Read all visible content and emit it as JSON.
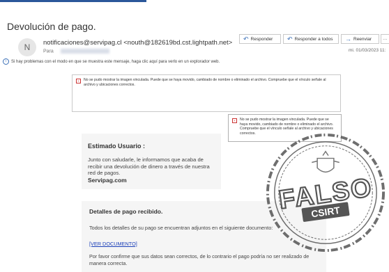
{
  "email": {
    "subject": "Devolución de pago.",
    "avatar_initial": "N",
    "sender": "notificaciones@servipag.cl <nouth@182619bd.cst.lightpath.net>",
    "to_label": "Para",
    "date": "mi. 01/03/2023 11:",
    "actions": {
      "reply": "Responder",
      "reply_all": "Responder a todos",
      "forward": "Reenviar",
      "more": "···"
    },
    "info_bar": "Si hay problemas con el modo en que se muestra este mensaje, haga clic aquí para verlo en un explorador web."
  },
  "broken_images": {
    "wide_text": "No se pudo mostrar la imagen vinculada. Puede que se haya movido, cambiado de nombre o eliminado el archivo. Compruebe que el vínculo señale al archivo y ubicaciones correctos.",
    "side_text": "No se pudo mostrar la imagen vinculada. Puede que se haya movido, cambiado de nombre o eliminado el archivo. Compruebe que el vínculo señale al archivo y ubicaciones correctos."
  },
  "message": {
    "greeting": "Estimado Usuario :",
    "body": "Junto con saludarle, le informamos que acaba de recibir una devolución de dinero a través de nuestra red de pagos.",
    "brand": "Servipag.com",
    "details_title": "Detalles de pago recibido.",
    "details_text": "Todos los detalles de su pago se encuentran adjuntos en el siguiente documento:",
    "doc_link": "[VER DOCUMENTO]",
    "warning": "Por favor confirme que sus datos sean correctos, de lo contrario el pago podría no ser realizado de manera correcta."
  },
  "stamp": {
    "word": "FALSO",
    "badge": "CSIRT",
    "color": "#555555"
  },
  "colors": {
    "accent": "#2b579a",
    "link": "#1a3fb8",
    "panel": "#f5f5f5"
  }
}
